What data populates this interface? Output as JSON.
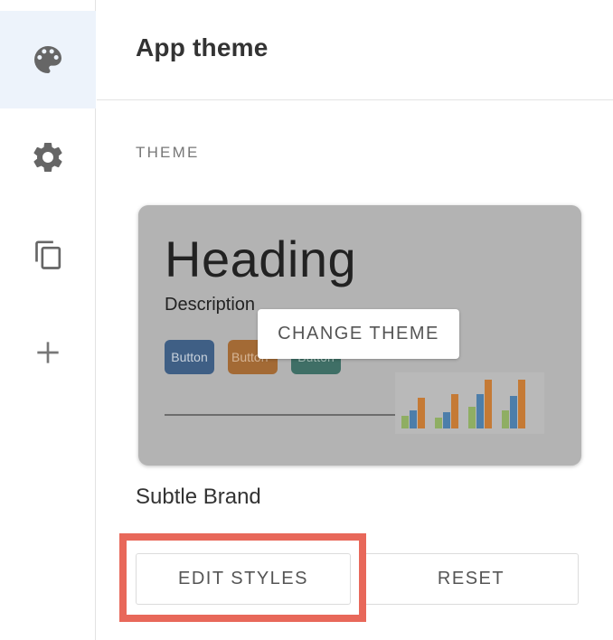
{
  "sidebar": {
    "items": [
      {
        "name": "palette-icon",
        "active": true
      },
      {
        "name": "gear-icon",
        "active": false
      },
      {
        "name": "copy-icon",
        "active": false
      },
      {
        "name": "plus-icon",
        "active": false
      }
    ],
    "icon_color": "#666666",
    "active_bg": "#edf3fb"
  },
  "header": {
    "title": "App theme"
  },
  "section": {
    "label": "THEME"
  },
  "theme_card": {
    "background": "#b3b3b3",
    "heading": "Heading",
    "description": "Description",
    "buttons": [
      {
        "label": "Button",
        "color": "#3f5f85"
      },
      {
        "label": "Button",
        "color": "#a36a35"
      },
      {
        "label": "Button",
        "color": "#3f6f66"
      }
    ],
    "chart_colors": [
      "#8fae63",
      "#4d7eaa",
      "#c57a35"
    ],
    "overlay_button": "CHANGE THEME"
  },
  "theme_name": "Subtle Brand",
  "actions": {
    "edit_label": "EDIT STYLES",
    "reset_label": "RESET",
    "highlight_color": "#e8685a"
  }
}
